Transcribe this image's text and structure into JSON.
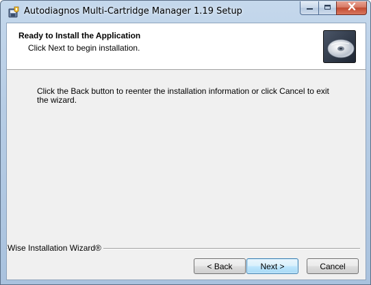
{
  "window": {
    "title": "Autodiagnos Multi-Cartridge Manager 1.19 Setup",
    "controls": {
      "minimize_icon": "minimize-icon",
      "maximize_icon": "maximize-icon",
      "close_icon": "close-icon"
    }
  },
  "header": {
    "title": "Ready to Install the Application",
    "subtitle": "Click Next to begin installation.",
    "graphic_icon": "cd-disc-icon"
  },
  "body": {
    "instructions": "Click the Back button to reenter the installation information or click Cancel to exit the wizard."
  },
  "footer": {
    "brand": "Wise Installation Wizard®",
    "back_label": "< Back",
    "next_label": "Next >",
    "cancel_label": "Cancel"
  },
  "colors": {
    "titlebar": "#b7cde5",
    "dialog_bg": "#f0f0f0",
    "header_bg": "#ffffff",
    "close_button": "#c24a31",
    "default_button_border": "#3c7fb1"
  }
}
